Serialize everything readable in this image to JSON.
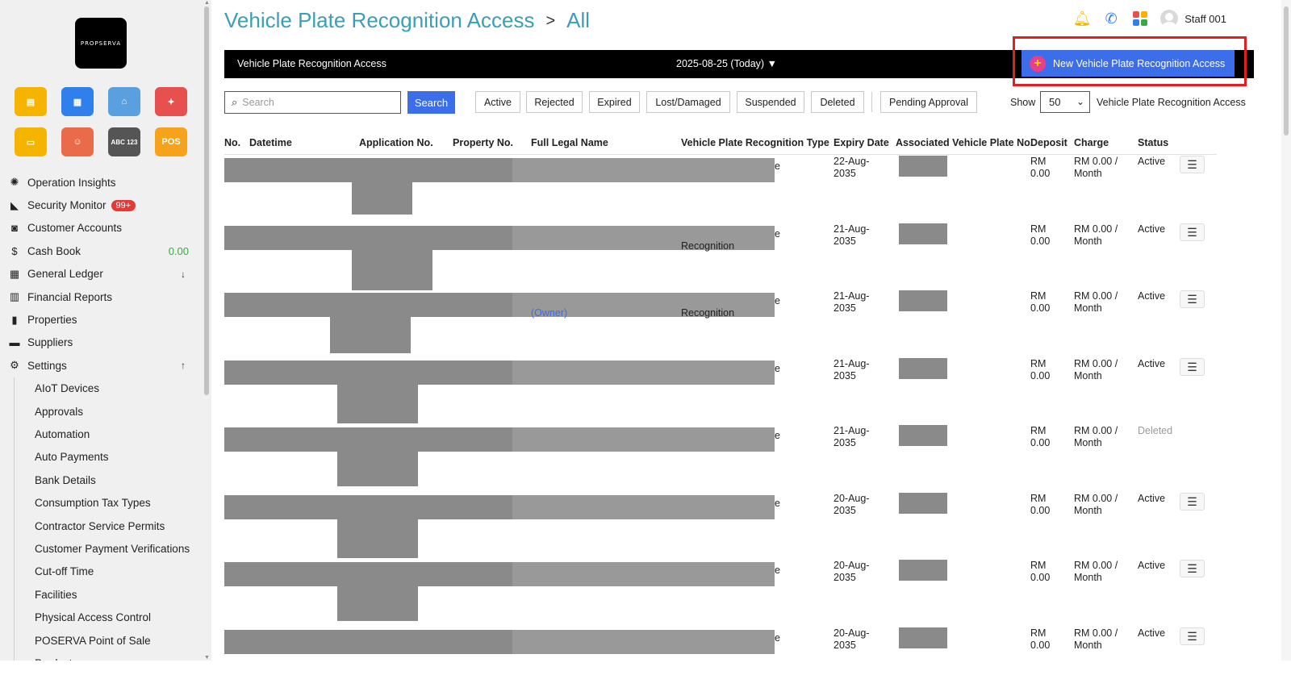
{
  "brand": {
    "logo_text": "PROPSERVA"
  },
  "apps": [
    {
      "icon": "id-card-icon",
      "color": "#f4b400",
      "glyph": "▤"
    },
    {
      "icon": "calendar-icon",
      "color": "#2f80ed",
      "glyph": "▦"
    },
    {
      "icon": "bank-icon",
      "color": "#5aa0e0",
      "glyph": "⌂"
    },
    {
      "icon": "shapes-icon",
      "color": "#e84f4f",
      "glyph": "✦"
    },
    {
      "icon": "card-key-icon",
      "color": "#f4b400",
      "glyph": "▭"
    },
    {
      "icon": "face-scan-icon",
      "color": "#ea6b4a",
      "glyph": "☺"
    },
    {
      "icon": "plate-abc123-icon",
      "color": "#555555",
      "glyph": "ABC 123"
    },
    {
      "icon": "pos-icon",
      "color": "#f7a21b",
      "glyph": "POS"
    }
  ],
  "nav": [
    {
      "label": "Operation Insights",
      "icon": "bulb-icon",
      "glyph": "✺"
    },
    {
      "label": "Security Monitor",
      "icon": "cctv-icon",
      "glyph": "◣",
      "badge": "99+"
    },
    {
      "label": "Customer Accounts",
      "icon": "contact-card-icon",
      "glyph": "◙"
    },
    {
      "label": "Cash Book",
      "icon": "dollar-icon",
      "glyph": "$",
      "amount": "0.00"
    },
    {
      "label": "General Ledger",
      "icon": "calculator-icon",
      "glyph": "▦",
      "arrow": "↓"
    },
    {
      "label": "Financial Reports",
      "icon": "report-icon",
      "glyph": "▥"
    },
    {
      "label": "Properties",
      "icon": "building-icon",
      "glyph": "▮"
    },
    {
      "label": "Suppliers",
      "icon": "truck-icon",
      "glyph": "▬"
    },
    {
      "label": "Settings",
      "icon": "gear-icon",
      "glyph": "⚙",
      "arrow": "↑"
    }
  ],
  "settings_items": [
    "AIoT Devices",
    "Approvals",
    "Automation",
    "Auto Payments",
    "Bank Details",
    "Consumption Tax Types",
    "Contractor Service Permits",
    "Customer Payment Verifications",
    "Cut-off Time",
    "Facilities",
    "Physical Access Control",
    "POSERVA Point of Sale",
    "Products"
  ],
  "header": {
    "title": "Vehicle Plate Recognition Access",
    "separator": ">",
    "subtitle": "All",
    "user": "Staff 001"
  },
  "toolbar": {
    "title": "Vehicle Plate Recognition Access",
    "date": "2025-08-25 (Today) ▼",
    "new_button": "New Vehicle Plate Recognition Access"
  },
  "filters": {
    "search_placeholder": "Search",
    "search_button": "Search",
    "buttons": [
      "Active",
      "Rejected",
      "Expired",
      "Lost/Damaged",
      "Suspended",
      "Deleted",
      "Pending Approval"
    ],
    "show_label": "Show",
    "show_value": "50",
    "show_suffix": "Vehicle Plate Recognition Access"
  },
  "table": {
    "headers": [
      "No.",
      "Datetime",
      "Application No.",
      "Property No.",
      "Full Legal Name",
      "Vehicle Plate Recognition Type",
      "Expiry Date",
      "Associated Vehicle Plate No.",
      "Deposit",
      "Charge",
      "Status"
    ],
    "rows": [
      {
        "expiry": "22-Aug-\n2035",
        "deposit": "RM\n0.00",
        "charge": "RM 0.00 /\nMonth",
        "status": "Active",
        "type_visible": "e",
        "type_line2": ""
      },
      {
        "expiry": "21-Aug-\n2035",
        "deposit": "RM\n0.00",
        "charge": "RM 0.00 /\nMonth",
        "status": "Active",
        "type_visible": "e",
        "type_line2": "Recognition"
      },
      {
        "expiry": "21-Aug-\n2035",
        "deposit": "RM\n0.00",
        "charge": "RM 0.00 /\nMonth",
        "status": "Active",
        "type_visible": "e",
        "type_line2": "Recognition",
        "name_link": "(Owner)"
      },
      {
        "expiry": "21-Aug-\n2035",
        "deposit": "RM\n0.00",
        "charge": "RM 0.00 /\nMonth",
        "status": "Active",
        "type_visible": "e",
        "type_line2": ""
      },
      {
        "expiry": "21-Aug-\n2035",
        "deposit": "RM\n0.00",
        "charge": "RM 0.00 /\nMonth",
        "status": "Deleted",
        "type_visible": "e",
        "type_line2": ""
      },
      {
        "expiry": "20-Aug-\n2035",
        "deposit": "RM\n0.00",
        "charge": "RM 0.00 /\nMonth",
        "status": "Active",
        "type_visible": "e",
        "type_line2": ""
      },
      {
        "expiry": "20-Aug-\n2035",
        "deposit": "RM\n0.00",
        "charge": "RM 0.00 /\nMonth",
        "status": "Active",
        "type_visible": "e",
        "type_line2": ""
      },
      {
        "expiry": "20-Aug-\n2035",
        "deposit": "RM\n0.00",
        "charge": "RM 0.00 /\nMonth",
        "status": "Active",
        "type_visible": "e",
        "type_line2": ""
      }
    ]
  },
  "colors": {
    "title_teal": "#3a9fb5",
    "primary_blue": "#3b6ee8",
    "highlight_red": "#e02020",
    "badge_red": "#e53935",
    "amount_green": "#3aa84a"
  }
}
